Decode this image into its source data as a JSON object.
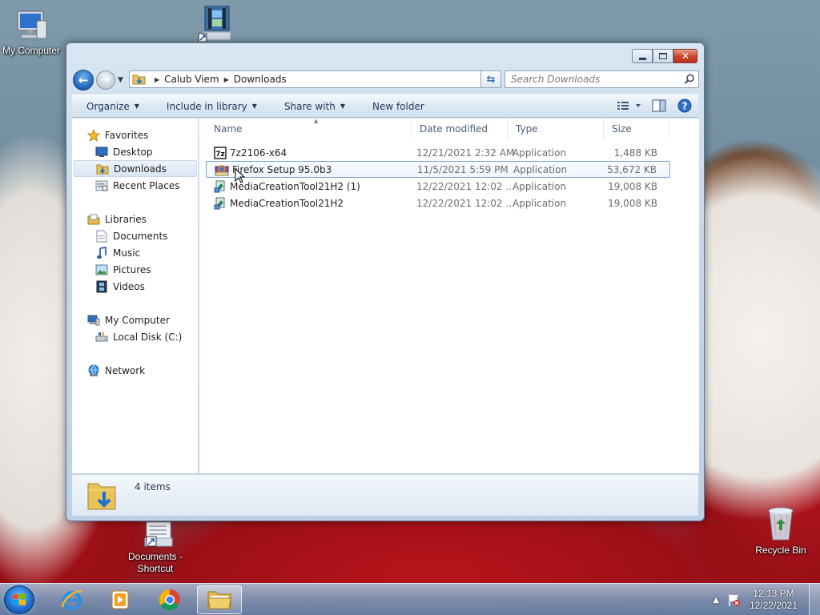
{
  "desktop": {
    "icons": {
      "my_computer": "My Computer",
      "documents_shortcut_1": "Documents -",
      "documents_shortcut_2": "Shortcut",
      "recycle_bin": "Recycle Bin"
    }
  },
  "window": {
    "breadcrumb": [
      "Calub Viem",
      "Downloads"
    ],
    "search_placeholder": "Search Downloads",
    "toolbar": {
      "organize": "Organize",
      "include_in_library": "Include in library",
      "share_with": "Share with",
      "new_folder": "New folder"
    },
    "nav": {
      "favorites": "Favorites",
      "desktop": "Desktop",
      "downloads": "Downloads",
      "recent_places": "Recent Places",
      "libraries": "Libraries",
      "documents": "Documents",
      "music": "Music",
      "pictures": "Pictures",
      "videos": "Videos",
      "my_computer": "My Computer",
      "local_disk": "Local Disk (C:)",
      "network": "Network"
    },
    "columns": {
      "name": "Name",
      "date_modified": "Date modified",
      "type": "Type",
      "size": "Size"
    },
    "files": [
      {
        "name": "7z2106-x64",
        "date": "12/21/2021 2:32 AM",
        "type": "Application",
        "size": "1,488 KB"
      },
      {
        "name": "Firefox Setup 95.0b3",
        "date": "11/5/2021 5:59 PM",
        "type": "Application",
        "size": "53,672 KB"
      },
      {
        "name": "MediaCreationTool21H2 (1)",
        "date": "12/22/2021 12:02 ...",
        "type": "Application",
        "size": "19,008 KB"
      },
      {
        "name": "MediaCreationTool21H2",
        "date": "12/22/2021 12:02 ...",
        "type": "Application",
        "size": "19,008 KB"
      }
    ],
    "status": "4 items"
  },
  "taskbar": {
    "time": "12:13 PM",
    "date": "12/22/2021"
  }
}
